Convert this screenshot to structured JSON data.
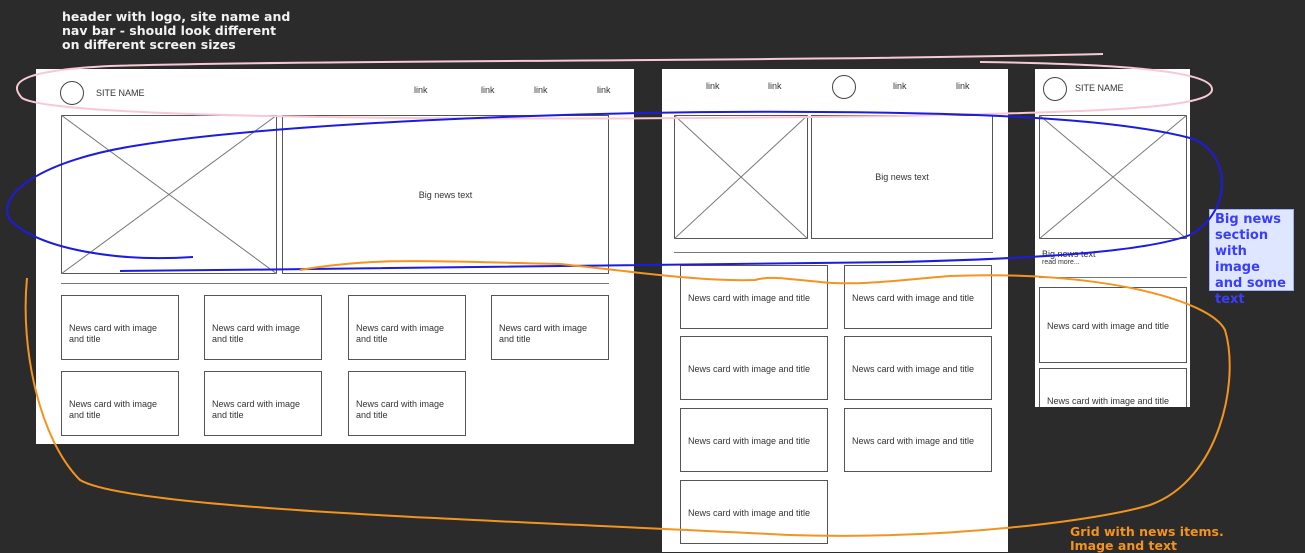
{
  "notes": {
    "header": "header with logo, site name and\nnav bar - should look different\non different screen sizes",
    "big_news": "Big news\nsection\nwith image\nand some\ntext",
    "grid": "Grid with news items.\nImage and text"
  },
  "desktop": {
    "site_name": "SITE NAME",
    "links": [
      "link",
      "link",
      "link",
      "link"
    ],
    "big_news_text": "Big news text",
    "card_label": "News card with image and title",
    "card_count": 7
  },
  "tablet": {
    "links_left": [
      "link",
      "link"
    ],
    "links_right": [
      "link",
      "link"
    ],
    "big_news_text": "Big news text",
    "card_label": "News card with image and title",
    "card_count": 7
  },
  "mobile": {
    "site_name": "SITE NAME",
    "big_news_text": "Big news text",
    "read_more": "read more...",
    "card_label": "News card with image and title",
    "card_count": 2
  },
  "colors": {
    "background": "#2b2b2b",
    "header_annotation": "#f7c9d4",
    "big_news_annotation": "#1c1ce0",
    "grid_annotation": "#f2941f"
  }
}
